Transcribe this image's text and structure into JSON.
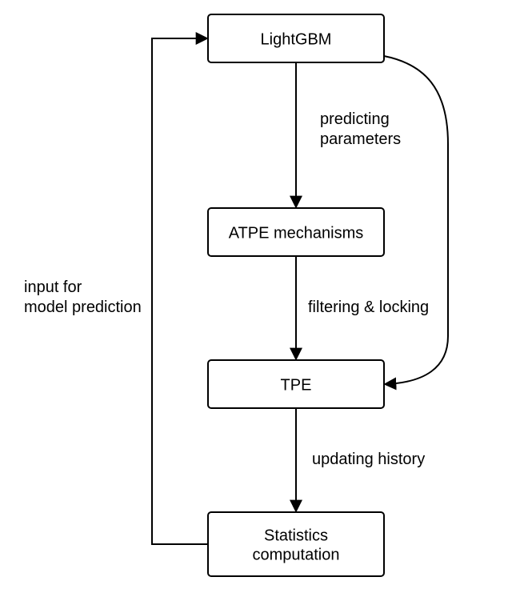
{
  "nodes": {
    "lightgbm": "LightGBM",
    "atpe": "ATPE mechanisms",
    "tpe": "TPE",
    "stats_line1": "Statistics",
    "stats_line2": "computation"
  },
  "edges": {
    "predicting_line1": "predicting",
    "predicting_line2": "parameters",
    "filtering": "filtering & locking",
    "updating": "updating history",
    "input_line1": "input for",
    "input_line2": "model prediction"
  }
}
